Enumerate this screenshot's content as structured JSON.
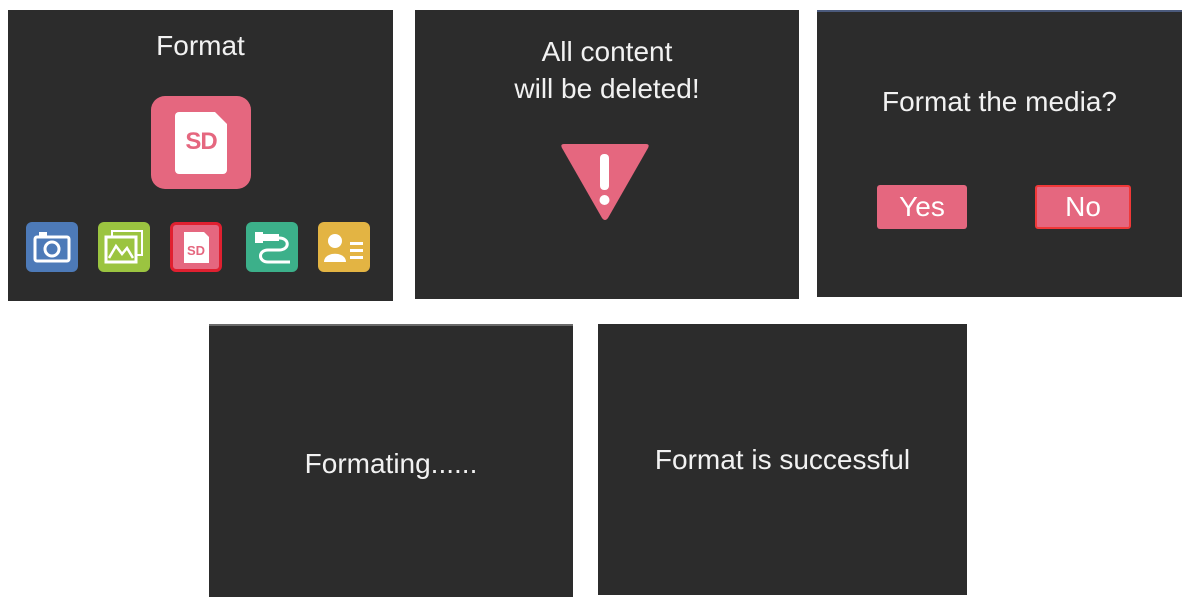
{
  "screens": {
    "format_menu": {
      "title": "Format",
      "big_icon_label": "SD",
      "menu_icons": [
        "camera-icon",
        "gallery-icon",
        "sd-card-icon",
        "usb-icon",
        "contact-icon"
      ],
      "selected_icon_label": "SD"
    },
    "warning": {
      "line1": "All content",
      "line2": "will be deleted!",
      "icon": "warning-triangle-icon"
    },
    "confirm": {
      "question": "Format the media?",
      "yes_label": "Yes",
      "no_label": "No"
    },
    "progress": {
      "text": "Formating......"
    },
    "success": {
      "text": "Format is successful"
    }
  },
  "colors": {
    "screen_bg": "#2c2c2c",
    "accent": "#e5677f",
    "text": "#f2f2f2"
  }
}
